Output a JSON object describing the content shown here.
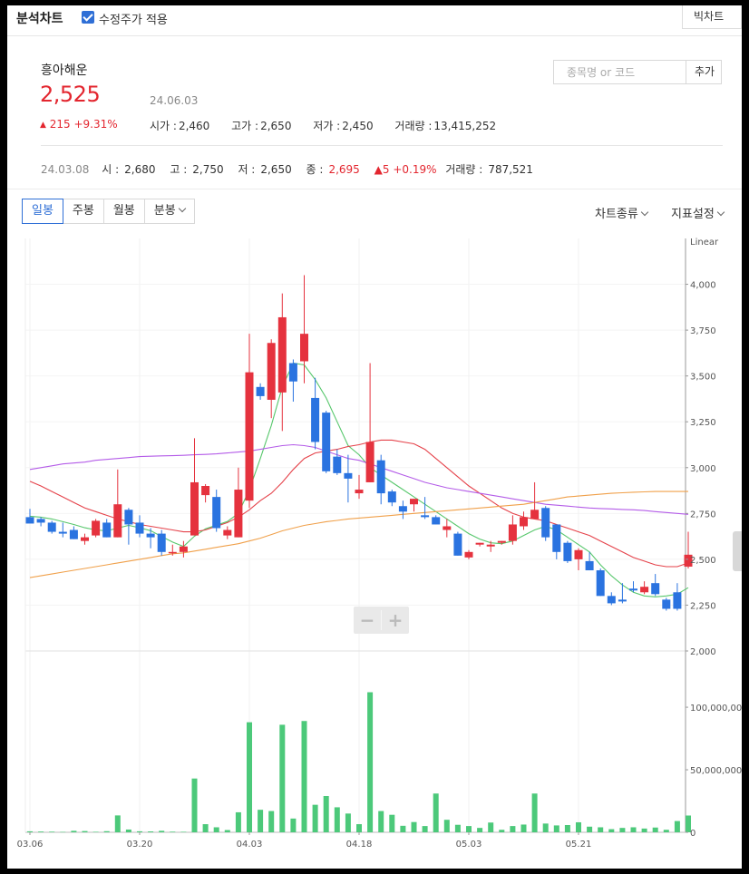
{
  "header": {
    "title": "분석차트",
    "adjusted_price_label": "수정주가 적용",
    "adjusted_price_checked": true,
    "bigchart_label": "빅차트"
  },
  "stock": {
    "name": "흥아해운",
    "price": "2,525",
    "date": "24.06.03",
    "change_arrow": "▲",
    "change_text": "215 +9.31%",
    "open_label": "시가 :",
    "open": "2,460",
    "high_label": "고가 :",
    "high": "2,650",
    "low_label": "저가 :",
    "low": "2,450",
    "volume_label": "거래량 :",
    "volume": "13,415,252"
  },
  "search": {
    "placeholder": "종목명 or 코드",
    "button_label": "추가"
  },
  "hover_info": {
    "date": "24.03.08",
    "open_label": "시 :",
    "open": "2,680",
    "high_label": "고 :",
    "high": "2,750",
    "low_label": "저 :",
    "low": "2,650",
    "close_label": "종 :",
    "close": "2,695",
    "change": "▲5 +0.19%",
    "volume_label": "거래량 :",
    "volume": "787,521"
  },
  "period_tabs": [
    "일봉",
    "주봉",
    "월봉",
    "분봉"
  ],
  "active_period": "일봉",
  "menus": {
    "chart_type_label": "차트종류",
    "indicator_label": "지표설정"
  },
  "zoom": {
    "minus": "−",
    "plus": "+"
  },
  "colors": {
    "up": "#e5323e",
    "down": "#2a73e0",
    "ma5": "#57c76c",
    "ma20": "#e5424a",
    "ma60": "#b45ce8",
    "ma120": "#f0a04a",
    "volume": "#4cc97a",
    "accent": "#2f6fd6"
  },
  "chart_data": [
    {
      "type": "candlestick",
      "scale_label": "Linear",
      "ylim": [
        2000,
        4250
      ],
      "y_ticks": [
        "4,000",
        "3,750",
        "3,500",
        "3,250",
        "3,000",
        "2,750",
        "2,500",
        "2,250",
        "2,000"
      ],
      "y_tick_values": [
        4000,
        3750,
        3500,
        3250,
        3000,
        2750,
        2500,
        2250,
        2000
      ],
      "x_ticks": [
        "03.06",
        "03.20",
        "04.03",
        "04.18",
        "05.03",
        "05.21"
      ],
      "x_tick_index": [
        0,
        10,
        20,
        30,
        40,
        50
      ],
      "candles": [
        [
          2730,
          2775,
          2700,
          2695
        ],
        [
          2720,
          2730,
          2680,
          2700
        ],
        [
          2700,
          2710,
          2640,
          2650
        ],
        [
          2650,
          2700,
          2620,
          2640
        ],
        [
          2660,
          2680,
          2610,
          2610
        ],
        [
          2600,
          2640,
          2580,
          2620
        ],
        [
          2630,
          2720,
          2620,
          2710
        ],
        [
          2700,
          2720,
          2620,
          2620
        ],
        [
          2620,
          2990,
          2620,
          2800
        ],
        [
          2770,
          2780,
          2580,
          2690
        ],
        [
          2700,
          2740,
          2620,
          2640
        ],
        [
          2640,
          2670,
          2560,
          2620
        ],
        [
          2640,
          2660,
          2520,
          2540
        ],
        [
          2540,
          2580,
          2520,
          2540
        ],
        [
          2540,
          2600,
          2510,
          2570
        ],
        [
          2630,
          3160,
          2630,
          2920
        ],
        [
          2850,
          2910,
          2810,
          2900
        ],
        [
          2840,
          2880,
          2650,
          2670
        ],
        [
          2630,
          2680,
          2610,
          2660
        ],
        [
          2620,
          3000,
          2620,
          2880
        ],
        [
          2820,
          3730,
          2780,
          3520
        ],
        [
          3440,
          3460,
          3370,
          3390
        ],
        [
          3370,
          3700,
          3270,
          3680
        ],
        [
          3410,
          3950,
          3200,
          3820
        ],
        [
          3570,
          3590,
          3360,
          3470
        ],
        [
          3580,
          4050,
          3460,
          3730
        ],
        [
          3380,
          3490,
          3100,
          3140
        ],
        [
          3300,
          3310,
          2970,
          2980
        ],
        [
          3060,
          3100,
          2960,
          2970
        ],
        [
          2970,
          3070,
          2810,
          2940
        ],
        [
          2860,
          2960,
          2830,
          2880
        ],
        [
          2920,
          3570,
          2920,
          3140
        ],
        [
          3040,
          3070,
          2800,
          2860
        ],
        [
          2870,
          2880,
          2790,
          2810
        ],
        [
          2790,
          2820,
          2720,
          2760
        ],
        [
          2800,
          2830,
          2760,
          2830
        ],
        [
          2740,
          2840,
          2720,
          2730
        ],
        [
          2730,
          2740,
          2690,
          2690
        ],
        [
          2660,
          2720,
          2620,
          2680
        ],
        [
          2640,
          2650,
          2520,
          2520
        ],
        [
          2510,
          2550,
          2500,
          2540
        ],
        [
          2580,
          2590,
          2570,
          2590
        ],
        [
          2570,
          2600,
          2540,
          2580
        ],
        [
          2590,
          2600,
          2580,
          2600
        ],
        [
          2600,
          2740,
          2580,
          2690
        ],
        [
          2680,
          2760,
          2660,
          2730
        ],
        [
          2720,
          2920,
          2720,
          2770
        ],
        [
          2780,
          2790,
          2600,
          2620
        ],
        [
          2690,
          2690,
          2500,
          2540
        ],
        [
          2590,
          2600,
          2480,
          2490
        ],
        [
          2500,
          2560,
          2440,
          2550
        ],
        [
          2490,
          2540,
          2440,
          2440
        ],
        [
          2440,
          2450,
          2300,
          2300
        ],
        [
          2300,
          2320,
          2250,
          2260
        ],
        [
          2280,
          2370,
          2260,
          2270
        ],
        [
          2340,
          2380,
          2320,
          2330
        ],
        [
          2320,
          2380,
          2310,
          2350
        ],
        [
          2370,
          2420,
          2300,
          2310
        ],
        [
          2280,
          2290,
          2220,
          2230
        ],
        [
          2320,
          2370,
          2220,
          2230
        ],
        [
          2460,
          2650,
          2450,
          2525
        ]
      ],
      "ma_series": [
        {
          "values": [
            2735,
            2730,
            2720,
            2705,
            2690,
            2672,
            2660,
            2655,
            2670,
            2685,
            2672,
            2656,
            2624,
            2594,
            2570,
            2626,
            2666,
            2686,
            2706,
            2750,
            2880,
            3050,
            3230,
            3440,
            3570,
            3560,
            3480,
            3380,
            3250,
            3120,
            3070,
            3000,
            2960,
            2920,
            2880,
            2840,
            2800,
            2760,
            2720,
            2680,
            2640,
            2610,
            2590,
            2585,
            2600,
            2630,
            2660,
            2680,
            2660,
            2620,
            2580,
            2540,
            2470,
            2410,
            2360,
            2320,
            2300,
            2295,
            2300,
            2310,
            2345
          ]
        },
        {
          "values": [
            2925,
            2900,
            2870,
            2840,
            2810,
            2780,
            2760,
            2740,
            2720,
            2705,
            2690,
            2680,
            2670,
            2660,
            2650,
            2650,
            2660,
            2680,
            2700,
            2730,
            2770,
            2820,
            2860,
            2920,
            2990,
            3050,
            3080,
            3090,
            3100,
            3115,
            3125,
            3140,
            3150,
            3150,
            3140,
            3130,
            3100,
            3050,
            3000,
            2950,
            2900,
            2860,
            2820,
            2780,
            2750,
            2730,
            2720,
            2710,
            2690,
            2670,
            2650,
            2630,
            2600,
            2570,
            2540,
            2510,
            2490,
            2470,
            2460,
            2460,
            2480
          ]
        },
        {
          "values": [
            2990,
            3000,
            3010,
            3020,
            3025,
            3030,
            3040,
            3045,
            3050,
            3055,
            3060,
            3062,
            3064,
            3065,
            3067,
            3070,
            3072,
            3075,
            3080,
            3085,
            3090,
            3100,
            3110,
            3120,
            3125,
            3120,
            3110,
            3090,
            3070,
            3050,
            3040,
            3020,
            3000,
            2980,
            2960,
            2940,
            2920,
            2905,
            2890,
            2880,
            2870,
            2860,
            2850,
            2840,
            2830,
            2820,
            2810,
            2800,
            2795,
            2790,
            2785,
            2780,
            2777,
            2775,
            2772,
            2770,
            2766,
            2760,
            2755,
            2750,
            2745
          ]
        },
        {
          "values": [
            2400,
            2410,
            2420,
            2430,
            2440,
            2450,
            2460,
            2470,
            2480,
            2490,
            2500,
            2510,
            2520,
            2530,
            2535,
            2545,
            2555,
            2565,
            2575,
            2585,
            2600,
            2615,
            2635,
            2655,
            2670,
            2685,
            2695,
            2705,
            2712,
            2720,
            2725,
            2730,
            2735,
            2740,
            2745,
            2750,
            2755,
            2760,
            2765,
            2770,
            2775,
            2780,
            2785,
            2790,
            2795,
            2800,
            2810,
            2820,
            2830,
            2840,
            2845,
            2850,
            2855,
            2860,
            2863,
            2866,
            2868,
            2870,
            2870,
            2870,
            2870
          ]
        }
      ]
    },
    {
      "type": "bar",
      "ylim": [
        0,
        145000000
      ],
      "y_ticks": [
        "100,000,000",
        "50,000,000",
        "0"
      ],
      "y_tick_values": [
        100000000,
        50000000,
        0
      ],
      "values": [
        787521,
        600000,
        500000,
        300000,
        1200000,
        1000000,
        400000,
        900000,
        13500000,
        2200000,
        800000,
        700000,
        1200000,
        500000,
        400000,
        43000000,
        6500000,
        4000000,
        1800000,
        16000000,
        88000000,
        18000000,
        17000000,
        86000000,
        11000000,
        89000000,
        22000000,
        29000000,
        20000000,
        15000000,
        6500000,
        112000000,
        17000000,
        14000000,
        5200000,
        8200000,
        5000000,
        31000000,
        10000000,
        6000000,
        5000000,
        3500000,
        7800000,
        2000000,
        5000000,
        6200000,
        31000000,
        7000000,
        5500000,
        5800000,
        8000000,
        4500000,
        4000000,
        2500000,
        3500000,
        4000000,
        3000000,
        3800000,
        2000000,
        9000000,
        13415252
      ]
    }
  ]
}
